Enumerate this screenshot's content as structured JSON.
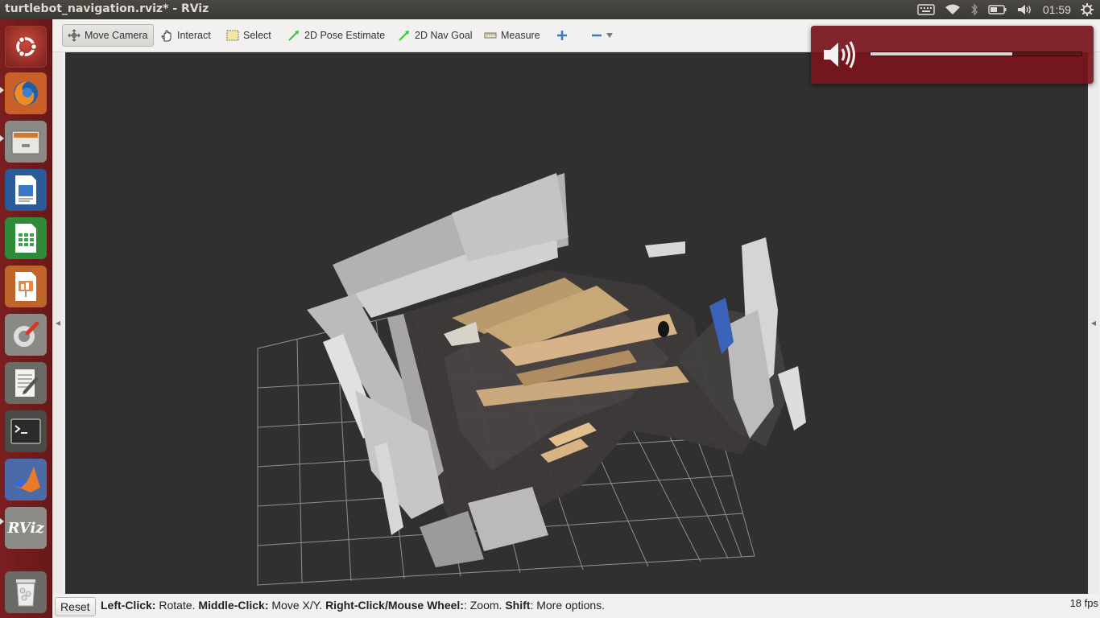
{
  "window": {
    "title": "turtlebot_navigation.rviz* - RViz"
  },
  "tray": {
    "keyboard_icon": "keyboard-icon",
    "wifi_icon": "wifi-icon",
    "bluetooth_icon": "bluetooth-icon",
    "battery_icon": "battery-icon",
    "volume_icon": "volume-icon",
    "clock": "01:59",
    "settings_icon": "gear-icon"
  },
  "launcher": {
    "items": [
      {
        "name": "ubuntu-dash",
        "icon": "ubuntu-logo-icon"
      },
      {
        "name": "firefox",
        "icon": "firefox-icon"
      },
      {
        "name": "files",
        "icon": "file-manager-icon"
      },
      {
        "name": "libreoffice-writer",
        "icon": "writer-icon"
      },
      {
        "name": "libreoffice-calc",
        "icon": "calc-icon"
      },
      {
        "name": "libreoffice-impress",
        "icon": "impress-icon"
      },
      {
        "name": "system-settings",
        "icon": "settings-icon"
      },
      {
        "name": "text-editor",
        "icon": "text-editor-icon"
      },
      {
        "name": "terminal",
        "icon": "terminal-icon"
      },
      {
        "name": "matlab",
        "icon": "matlab-icon"
      },
      {
        "name": "rviz",
        "icon": "rviz-icon",
        "label": "RViz"
      },
      {
        "name": "trash",
        "icon": "trash-icon"
      }
    ]
  },
  "toolbar": {
    "move_camera": "Move Camera",
    "interact": "Interact",
    "select": "Select",
    "pose_estimate": "2D Pose Estimate",
    "nav_goal": "2D Nav Goal",
    "measure": "Measure"
  },
  "status": {
    "reset": "Reset",
    "left_click": "Left-Click:",
    "rotate": " Rotate. ",
    "middle_click": "Middle-Click:",
    "move_xy": " Move X/Y. ",
    "right_click": "Right-Click/Mouse Wheel:",
    "zoom": ": Zoom. ",
    "shift": "Shift",
    "more": ": More options.",
    "fps": "18 fps"
  },
  "volume_osd": {
    "level_fraction": 0.67
  },
  "colors": {
    "launcher": "#7a1f1f",
    "viewport": "#303030",
    "osd": "#7a141c",
    "nav_arrow": "#2ecc2e"
  }
}
